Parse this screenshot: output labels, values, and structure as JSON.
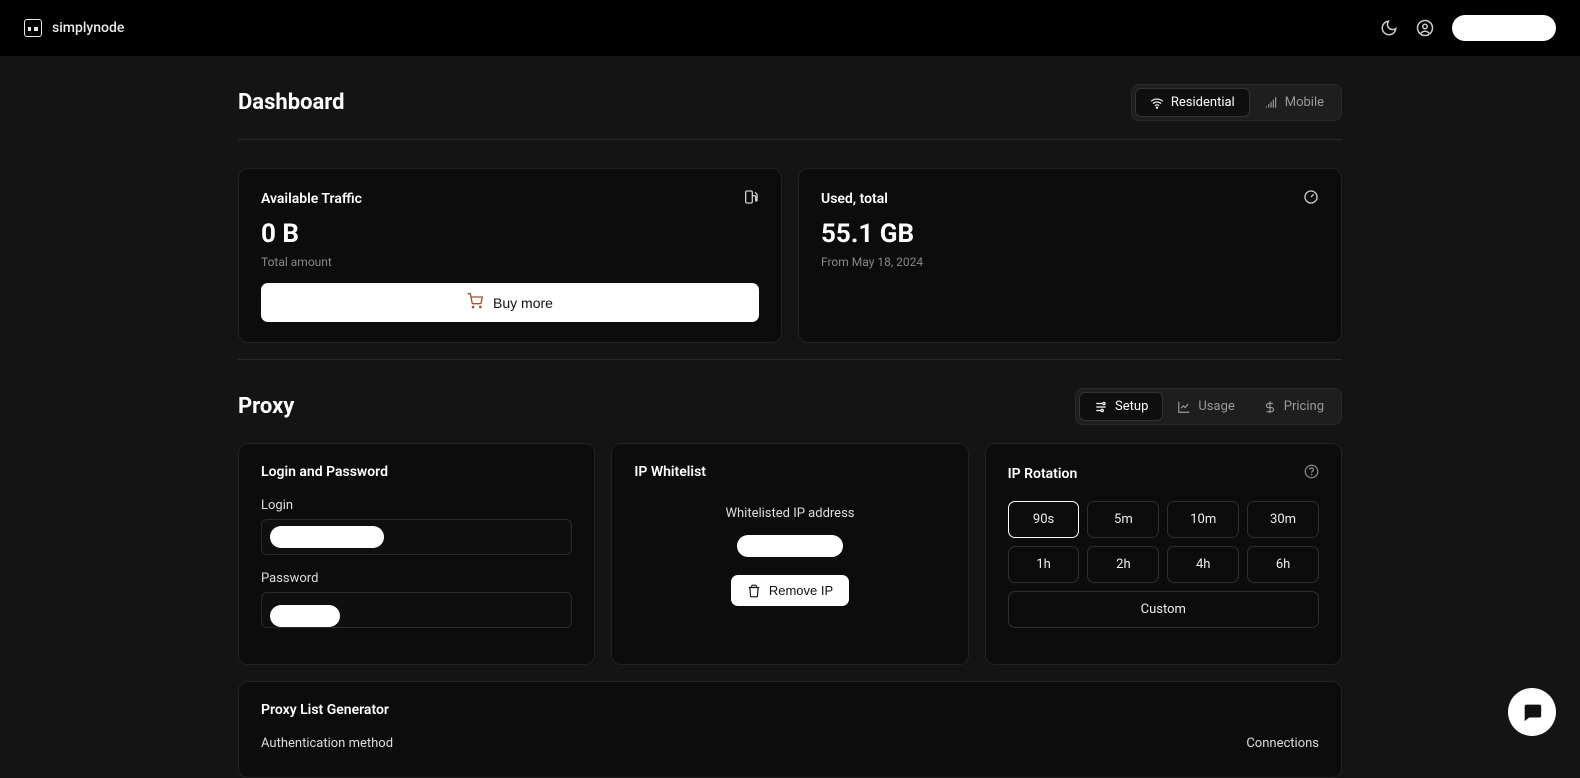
{
  "brand": "simplynode",
  "header": {
    "title": "Dashboard",
    "tabs": {
      "residential": "Residential",
      "mobile": "Mobile"
    }
  },
  "traffic": {
    "label": "Available Traffic",
    "value": "0 B",
    "sub": "Total amount",
    "buy": "Buy more"
  },
  "used": {
    "label": "Used, total",
    "value": "55.1 GB",
    "sub": "From May 18, 2024"
  },
  "proxy": {
    "title": "Proxy",
    "tabs": {
      "setup": "Setup",
      "usage": "Usage",
      "pricing": "Pricing"
    }
  },
  "login_card": {
    "title": "Login and Password",
    "login_label": "Login",
    "password_label": "Password"
  },
  "whitelist": {
    "title": "IP Whitelist",
    "label": "Whitelisted IP address",
    "remove": "Remove IP"
  },
  "rotation": {
    "title": "IP Rotation",
    "options": [
      "90s",
      "5m",
      "10m",
      "30m",
      "1h",
      "2h",
      "4h",
      "6h"
    ],
    "custom": "Custom"
  },
  "generator": {
    "title": "Proxy List Generator",
    "auth_label": "Authentication method",
    "conn_label": "Connections"
  }
}
